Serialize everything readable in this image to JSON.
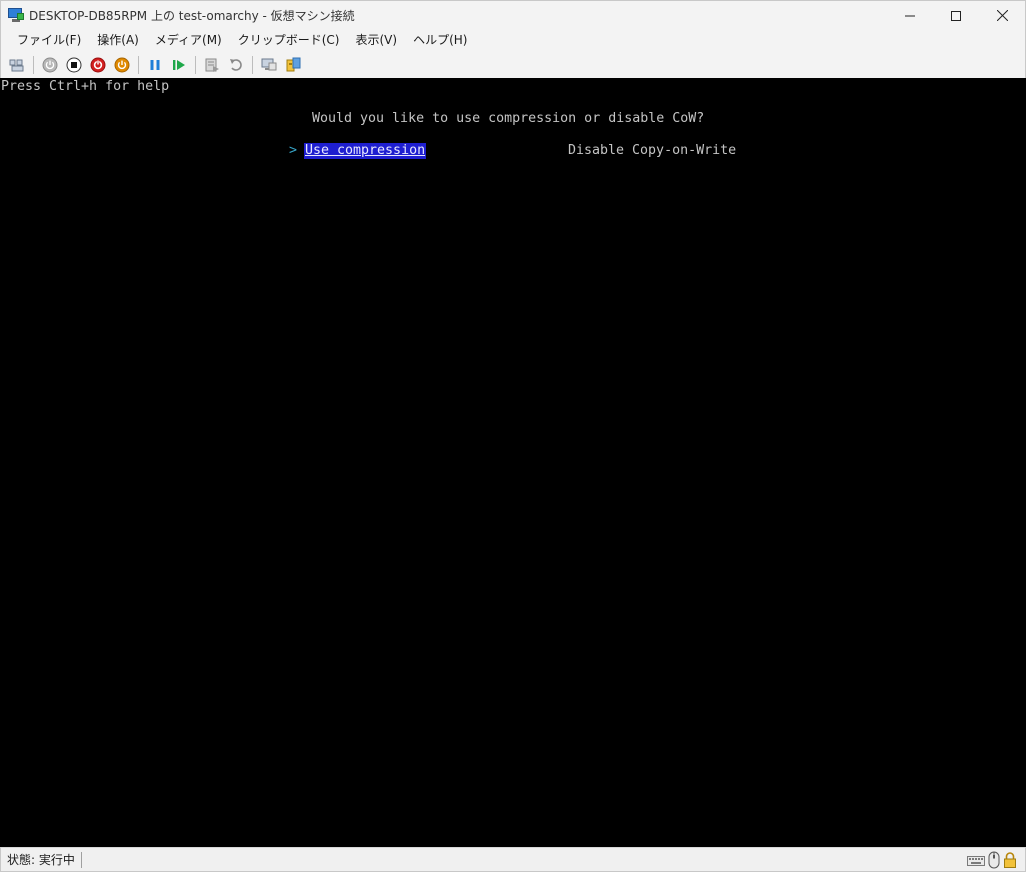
{
  "window": {
    "title": "DESKTOP-DB85RPM 上の test-omarchy  - 仮想マシン接続",
    "controls": {
      "minimize_icon": "minimize-icon",
      "maximize_icon": "maximize-icon",
      "close_icon": "close-icon"
    }
  },
  "menu": {
    "items": [
      {
        "label": "ファイル(F)"
      },
      {
        "label": "操作(A)"
      },
      {
        "label": "メディア(M)"
      },
      {
        "label": "クリップボード(C)"
      },
      {
        "label": "表示(V)"
      },
      {
        "label": "ヘルプ(H)"
      }
    ]
  },
  "toolbar": {
    "buttons": [
      {
        "icon": "ctrl-alt-del-icon"
      },
      {
        "icon": "start-icon",
        "color": "#9a9a9a"
      },
      {
        "icon": "turn-off-icon",
        "color": "#222222"
      },
      {
        "icon": "shut-down-icon",
        "color": "#d21f1f"
      },
      {
        "icon": "save-icon",
        "color": "#e08a00"
      },
      {
        "icon": "pause-icon",
        "color": "#1e7fd8"
      },
      {
        "icon": "reset-icon",
        "color": "#1ea84a"
      },
      {
        "icon": "checkpoint-icon"
      },
      {
        "icon": "revert-icon"
      },
      {
        "icon": "enhanced-session-icon"
      },
      {
        "icon": "share-icon"
      }
    ]
  },
  "console": {
    "help_text": "Press Ctrl+h for help",
    "question": "Would you like to use compression or disable CoW?",
    "caret": ">",
    "options": [
      {
        "label": "Use compression",
        "selected": true
      },
      {
        "label": "Disable Copy-on-Write",
        "selected": false
      }
    ],
    "colors": {
      "background": "#000000",
      "text": "#c4c4c4",
      "selection_bg": "#1e1ed0",
      "caret": "#37a6c9"
    }
  },
  "statusbar": {
    "status_text": "状態: 実行中",
    "icons": [
      "keyboard-icon",
      "mouse-icon",
      "lock-icon"
    ]
  }
}
